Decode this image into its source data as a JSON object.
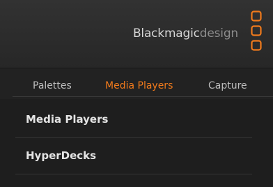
{
  "brand": {
    "name_part1": "Blackmagic",
    "name_part2": "design",
    "logo_icon": "blackmagic-logo-icon",
    "accent_color": "#f07a1c"
  },
  "tabs": [
    {
      "label": "Palettes",
      "active": false
    },
    {
      "label": "Media Players",
      "active": true
    },
    {
      "label": "Capture",
      "active": false
    }
  ],
  "sections": [
    {
      "label": "Media Players"
    },
    {
      "label": "HyperDecks"
    }
  ]
}
